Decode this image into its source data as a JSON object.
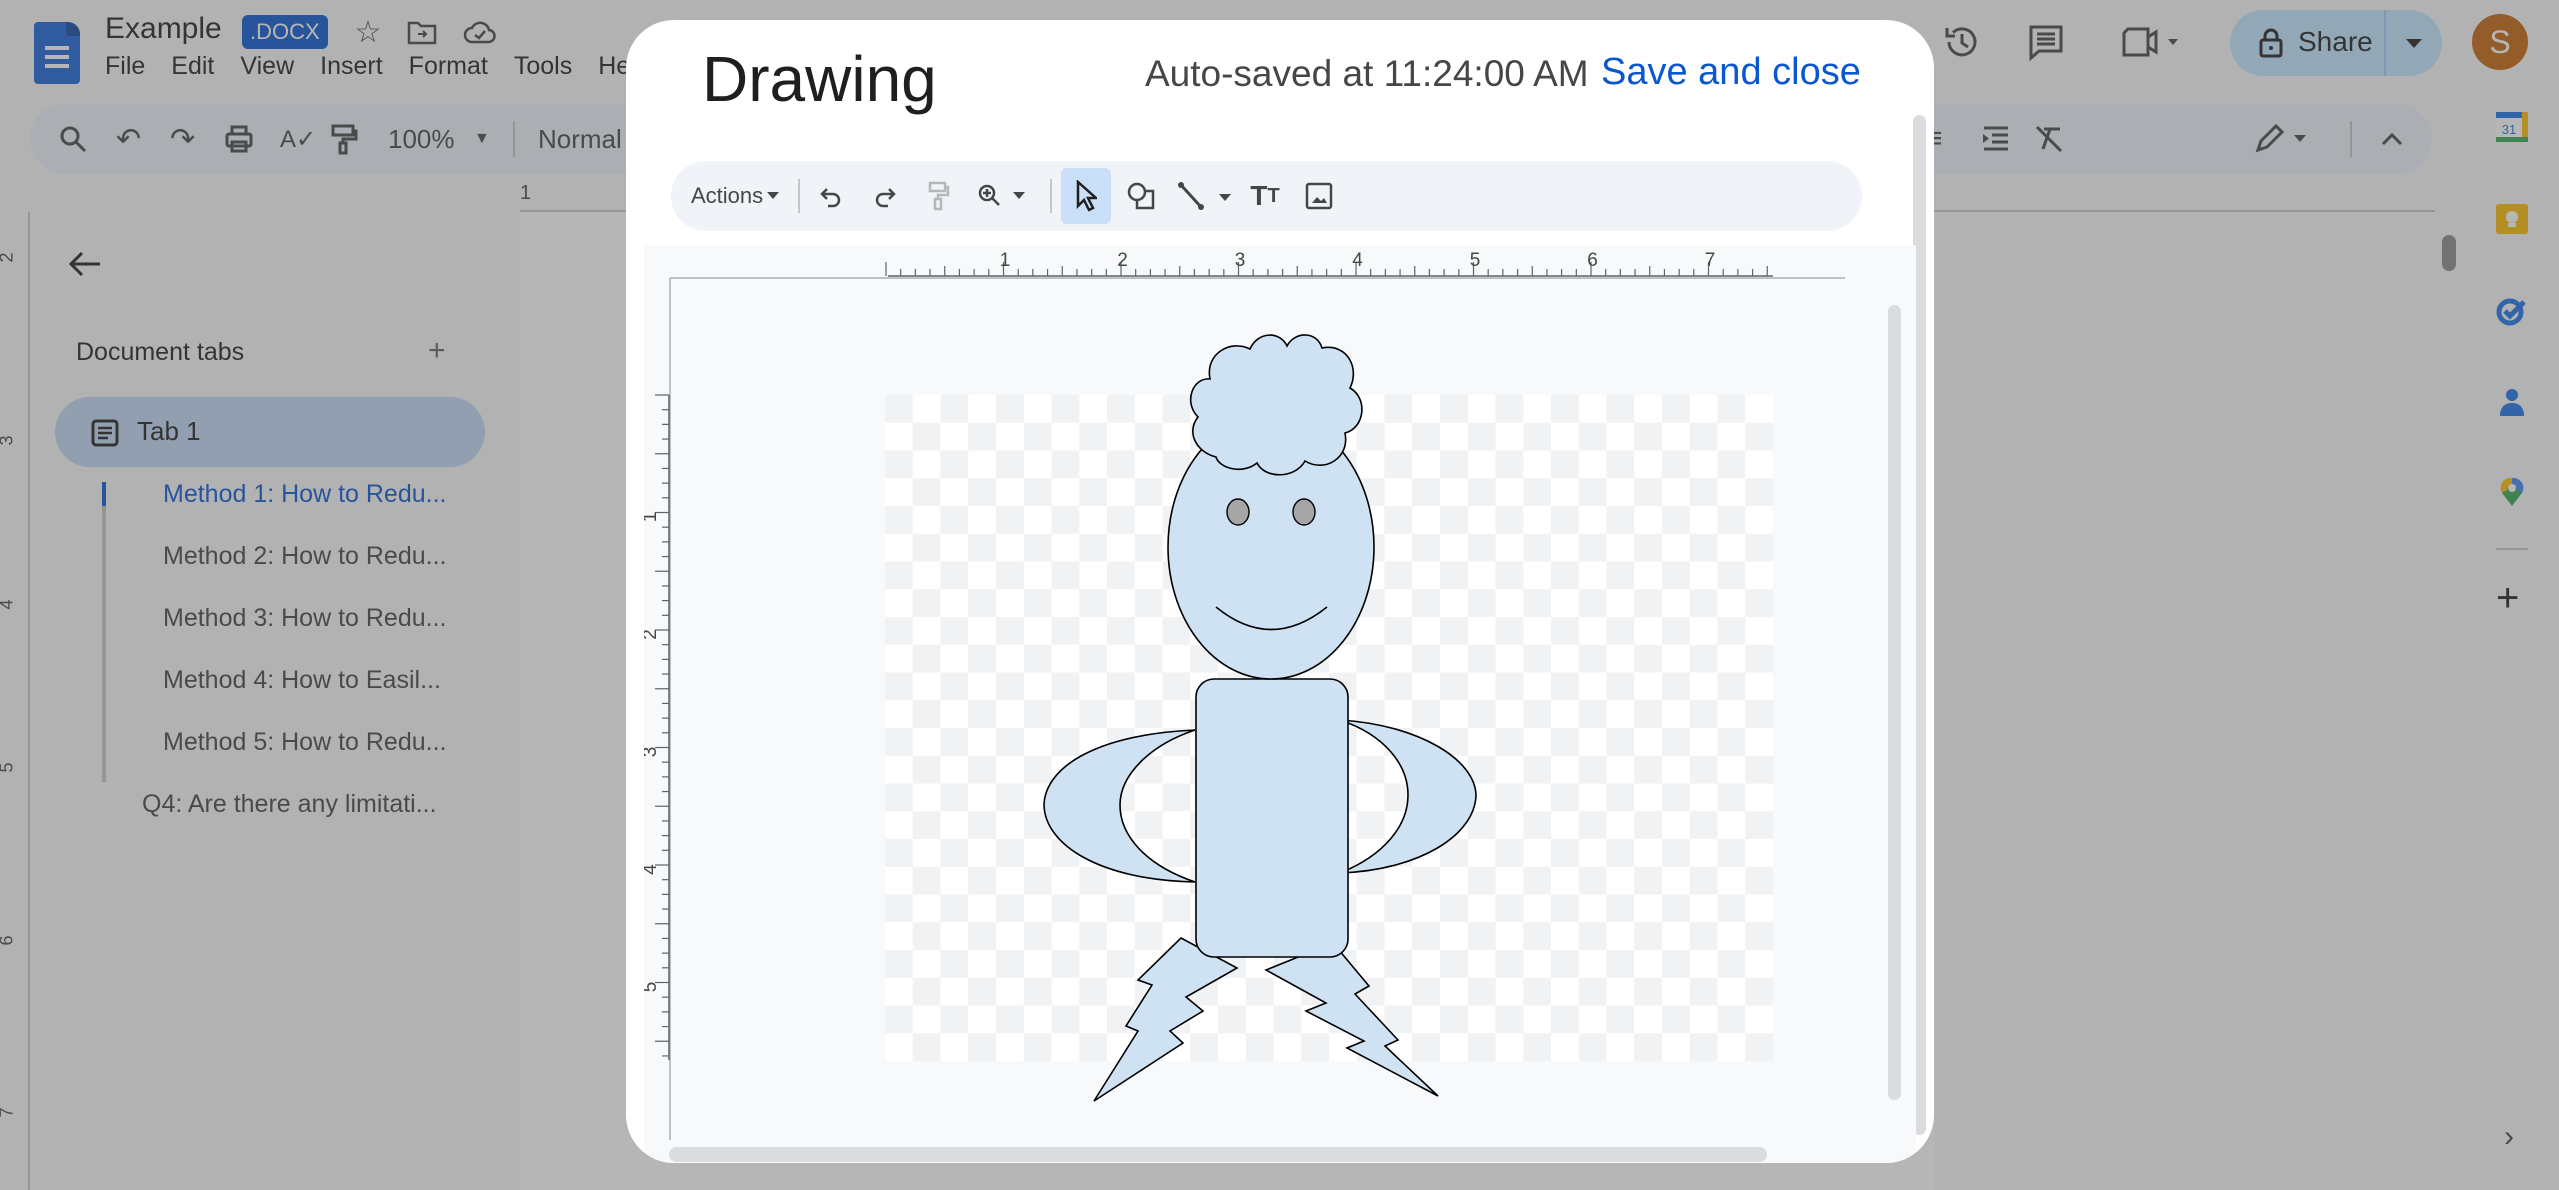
{
  "app": {
    "doc_title": "Example",
    "file_badge": ".DOCX",
    "menu": [
      "File",
      "Edit",
      "View",
      "Insert",
      "Format",
      "Tools",
      "He"
    ],
    "toolbar": {
      "zoom": "100%",
      "style": "Normal"
    },
    "share_label": "Share",
    "avatar_initial": "S",
    "colors": {
      "brand_blue": "#1a62d8",
      "badge_blue": "#0b57d0",
      "avatar": "#c3650c",
      "share_bg": "#c2e7ff"
    }
  },
  "ruler": {
    "top_labels": [
      "1"
    ],
    "left_labels": [
      "2",
      "3",
      "4",
      "5",
      "6",
      "7"
    ]
  },
  "sidebar": {
    "heading": "Document tabs",
    "tab": "Tab 1",
    "outline": [
      {
        "label": "Method 1: How to Redu...",
        "active": true
      },
      {
        "label": "Method 2: How to Redu...",
        "active": false
      },
      {
        "label": "Method 3: How to Redu...",
        "active": false
      },
      {
        "label": "Method 4: How to Easil...",
        "active": false
      },
      {
        "label": "Method 5: How to Redu...",
        "active": false
      },
      {
        "label": "Q4: Are there any limitati...",
        "active": false
      }
    ]
  },
  "right_rail": [
    "calendar-icon",
    "keep-icon",
    "tasks-icon",
    "contacts-icon",
    "maps-icon",
    "add-icon"
  ],
  "dialog": {
    "title": "Drawing",
    "autosave": "Auto-saved at 11:24:00 AM",
    "save_close": "Save and close",
    "toolbar": {
      "actions_label": "Actions",
      "tools": [
        "undo",
        "redo",
        "paint-format",
        "zoom",
        "select",
        "shape",
        "line",
        "text-box",
        "image"
      ],
      "active_tool": "select"
    },
    "ruler_h_labels": [
      "1",
      "2",
      "3",
      "4",
      "5",
      "6",
      "7"
    ],
    "ruler_v_labels": [
      "1",
      "2",
      "3",
      "4",
      "5"
    ],
    "drawing": {
      "fill": "#cfe2f3",
      "stroke": "#000000",
      "eye_fill": "#a6a6a6",
      "shapes": [
        "hair-cloud",
        "head-oval",
        "left-eye",
        "right-eye",
        "smile-arc",
        "body-rounded-rect",
        "left-arm-moon",
        "right-arm-moon",
        "left-leg-lightning",
        "right-leg-lightning"
      ]
    }
  }
}
